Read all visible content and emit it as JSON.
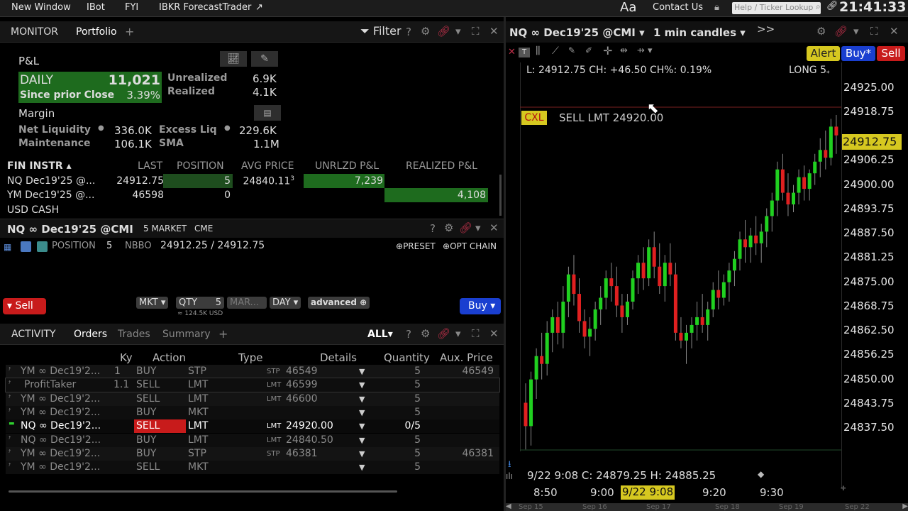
{
  "topbar": {
    "items": [
      "New Window",
      "IBot",
      "FYI",
      "IBKR ForecastTrader"
    ],
    "font_icon": "Aa",
    "contact": "Contact Us",
    "help_placeholder": "Help / Ticker Lookup",
    "clock": "21:41:33"
  },
  "monitor": {
    "tabs": [
      "MONITOR",
      "Portfolio"
    ],
    "filter_label": "Filter",
    "pnl_title": "P&L",
    "daily_label": "DAILY",
    "daily_value": "11,021",
    "since_label": "Since prior Close",
    "since_value": "3.39%",
    "unrealized_label": "Unrealized",
    "unrealized_value": "6.9K",
    "realized_label": "Realized",
    "realized_value": "4.1K",
    "margin_title": "Margin",
    "net_liq_label": "Net Liquidity",
    "net_liq_value": "336.0K",
    "excess_label": "Excess Liq",
    "excess_value": "229.6K",
    "maint_label": "Maintenance",
    "maint_value": "106.1K",
    "sma_label": "SMA",
    "sma_value": "1.1M",
    "columns": [
      "FIN INSTR",
      "LAST",
      "POSITION",
      "AVG PRICE",
      "UNRLZD P&L",
      "REALIZED P&L"
    ],
    "rows": [
      {
        "instr": "NQ Dec19'25 @...",
        "last": "24912.75",
        "position": "5",
        "avg": "24840.11",
        "avg_sup": "3",
        "unrlzd": "7,239",
        "realized": ""
      },
      {
        "instr": "YM Dec19'25 @...",
        "last": "46598",
        "position": "0",
        "avg": "",
        "avg_sup": "",
        "unrlzd": "",
        "realized": "4,108"
      },
      {
        "instr": "USD CASH",
        "last": "",
        "position": "",
        "avg": "",
        "avg_sup": "",
        "unrlzd": "",
        "realized": ""
      }
    ]
  },
  "order_entry": {
    "title": "NQ ∞ Dec19'25 @CMI",
    "market": "5 MARKET",
    "exchange": "CME",
    "position_label": "POSITION",
    "position_value": "5",
    "nbbo_label": "NBBO",
    "nbbo_value": "24912.25 / 24912.75",
    "preset": "PRESET",
    "opt_chain": "OPT CHAIN",
    "sell": "Sell",
    "buy": "Buy",
    "order_type": "MKT",
    "qty_label": "QTY",
    "qty_value": "5",
    "mar": "MAR...",
    "tif": "DAY",
    "advanced": "advanced",
    "notional": "≈ 124.5K USD"
  },
  "activity": {
    "tabs": [
      "ACTIVITY",
      "Orders",
      "Trades",
      "Summary"
    ],
    "filter": "ALL",
    "columns": [
      "Ky",
      "Action",
      "Type",
      "Details",
      "Quantity",
      "Aux. Price"
    ],
    "rows": [
      {
        "instr": "YM ∞ Dec19'2...",
        "ky": "1",
        "action": "BUY",
        "type": "STP",
        "dtype": "STP",
        "detail": "46549",
        "qty": "5",
        "aux": "46549",
        "state": "dim"
      },
      {
        "instr": "ProfitTaker",
        "ky": "1.1",
        "action": "SELL",
        "type": "LMT",
        "dtype": "LMT",
        "detail": "46599",
        "qty": "5",
        "aux": "",
        "state": "dim"
      },
      {
        "instr": "YM ∞ Dec19'2...",
        "ky": "",
        "action": "SELL",
        "type": "LMT",
        "dtype": "LMT",
        "detail": "46600",
        "qty": "5",
        "aux": "",
        "state": "dim"
      },
      {
        "instr": "YM ∞ Dec19'2...",
        "ky": "",
        "action": "BUY",
        "type": "MKT",
        "dtype": "",
        "detail": "",
        "qty": "5",
        "aux": "",
        "state": "dim"
      },
      {
        "instr": "NQ ∞ Dec19'2...",
        "ky": "",
        "action": "SELL",
        "type": "LMT",
        "dtype": "LMT",
        "detail": "24920.00",
        "qty": "0/5",
        "aux": "",
        "state": "active"
      },
      {
        "instr": "NQ ∞ Dec19'2...",
        "ky": "",
        "action": "BUY",
        "type": "LMT",
        "dtype": "LMT",
        "detail": "24840.50",
        "qty": "5",
        "aux": "",
        "state": "dim"
      },
      {
        "instr": "YM ∞ Dec19'2...",
        "ky": "",
        "action": "BUY",
        "type": "STP",
        "dtype": "STP",
        "detail": "46381",
        "qty": "5",
        "aux": "46381",
        "state": "dim"
      },
      {
        "instr": "YM ∞ Dec19'2...",
        "ky": "",
        "action": "SELL",
        "type": "MKT",
        "dtype": "",
        "detail": "",
        "qty": "5",
        "aux": "",
        "state": "dim"
      }
    ]
  },
  "chart": {
    "title": "NQ ∞ Dec19'25 @CMI",
    "interval": "1 min candles",
    "alert": "Alert",
    "buy": "Buy*",
    "sell": "Sell",
    "info": "L: 24912.75 CH: +46.50 CH%: 0.19%",
    "long": "LONG 5",
    "cxl": "CXL",
    "order_line": "SELL LMT 24920.00",
    "bottom_info": "9/22 9:08 C: 24879.25 H: 24885.25",
    "y_labels": [
      "24925.00",
      "24918.75",
      "24906.25",
      "24900.00",
      "24893.75",
      "24887.50",
      "24881.25",
      "24875.00",
      "24868.75",
      "24862.50",
      "24856.25",
      "24850.00",
      "24843.75",
      "24837.50"
    ],
    "last_price": "24912.75",
    "x_labels": [
      "8:50",
      "9:00",
      "9:20",
      "9:30"
    ],
    "x_cursor": "9/22 9:08",
    "nav_labels": [
      "Sep 15",
      "Sep 16",
      "Sep 17",
      "Sep 18",
      "Sep 19",
      "Sep 22"
    ]
  },
  "chart_data": {
    "type": "candlestick",
    "ylim": [
      24831.5,
      24931.5
    ],
    "candles": [
      [
        24844,
        24849,
        24832,
        24838
      ],
      [
        24838,
        24852,
        24833,
        24850
      ],
      [
        24850,
        24858,
        24845,
        24856
      ],
      [
        24856,
        24862,
        24850,
        24854
      ],
      [
        24854,
        24865,
        24851,
        24862
      ],
      [
        24862,
        24868,
        24857,
        24866
      ],
      [
        24866,
        24870,
        24859,
        24862
      ],
      [
        24862,
        24874,
        24858,
        24870
      ],
      [
        24870,
        24879,
        24866,
        24877
      ],
      [
        24877,
        24882,
        24869,
        24872
      ],
      [
        24872,
        24876,
        24862,
        24865
      ],
      [
        24865,
        24868,
        24858,
        24861
      ],
      [
        24861,
        24866,
        24856,
        24863
      ],
      [
        24863,
        24870,
        24860,
        24868
      ],
      [
        24868,
        24874,
        24864,
        24871
      ],
      [
        24871,
        24878,
        24868,
        24876
      ],
      [
        24876,
        24880,
        24870,
        24874
      ],
      [
        24874,
        24879,
        24866,
        24869
      ],
      [
        24869,
        24872,
        24862,
        24866
      ],
      [
        24866,
        24872,
        24864,
        24870
      ],
      [
        24870,
        24878,
        24868,
        24876
      ],
      [
        24876,
        24882,
        24872,
        24880
      ],
      [
        24880,
        24884,
        24873,
        24876
      ],
      [
        24876,
        24886,
        24874,
        24884
      ],
      [
        24884,
        24888,
        24876,
        24879
      ],
      [
        24879,
        24885,
        24872,
        24874
      ],
      [
        24874,
        24882,
        24870,
        24880
      ],
      [
        24880,
        24885,
        24874,
        24877
      ],
      [
        24877,
        24880,
        24860,
        24862
      ],
      [
        24862,
        24866,
        24858,
        24860
      ],
      [
        24860,
        24864,
        24854,
        24862
      ],
      [
        24862,
        24866,
        24858,
        24864
      ],
      [
        24864,
        24870,
        24860,
        24866
      ],
      [
        24866,
        24872,
        24862,
        24864
      ],
      [
        24864,
        24870,
        24860,
        24868
      ],
      [
        24868,
        24875,
        24866,
        24873
      ],
      [
        24873,
        24878,
        24868,
        24871
      ],
      [
        24871,
        24877,
        24869,
        24875
      ],
      [
        24875,
        24880,
        24870,
        24878
      ],
      [
        24878,
        24883,
        24874,
        24881
      ],
      [
        24881,
        24888,
        24878,
        24886
      ],
      [
        24886,
        24891,
        24880,
        24884
      ],
      [
        24884,
        24889,
        24880,
        24887
      ],
      [
        24887,
        24892,
        24882,
        24885
      ],
      [
        24885,
        24890,
        24880,
        24888
      ],
      [
        24888,
        24894,
        24884,
        24892
      ],
      [
        24892,
        24898,
        24888,
        24896
      ],
      [
        24896,
        24906,
        24892,
        24904
      ],
      [
        24904,
        24908,
        24896,
        24898
      ],
      [
        24898,
        24903,
        24892,
        24895
      ],
      [
        24895,
        24900,
        24893,
        24898
      ],
      [
        24898,
        24904,
        24895,
        24902
      ],
      [
        24902,
        24905,
        24896,
        24899
      ],
      [
        24899,
        24904,
        24896,
        24903
      ],
      [
        24903,
        24908,
        24900,
        24906
      ],
      [
        24906,
        24912,
        24902,
        24909
      ],
      [
        24909,
        24914,
        24904,
        24907
      ],
      [
        24907,
        24917,
        24905,
        24915
      ],
      [
        24915,
        24918,
        24908,
        24912.75
      ]
    ]
  }
}
